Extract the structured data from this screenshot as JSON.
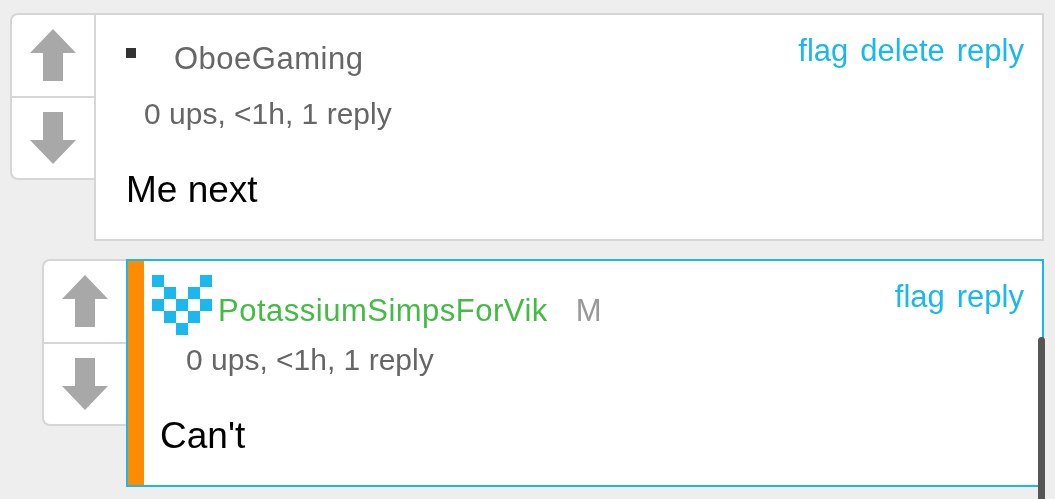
{
  "comments": [
    {
      "highlighted": false,
      "avatar": {
        "kind": "square"
      },
      "username": "OboeGaming",
      "color": "#666666",
      "meta": "0 ups, <1h, 1 reply",
      "body": "Me next",
      "actions": [
        "flag",
        "delete",
        "reply"
      ]
    },
    {
      "highlighted": true,
      "avatar": {
        "kind": "pixel-v"
      },
      "username": "PotassiumSimpsForVik",
      "color": "#44bb44",
      "badge": "M",
      "meta": "0 ups, <1h, 1 reply",
      "body": "Can't",
      "actions": [
        "flag",
        "reply"
      ]
    }
  ]
}
